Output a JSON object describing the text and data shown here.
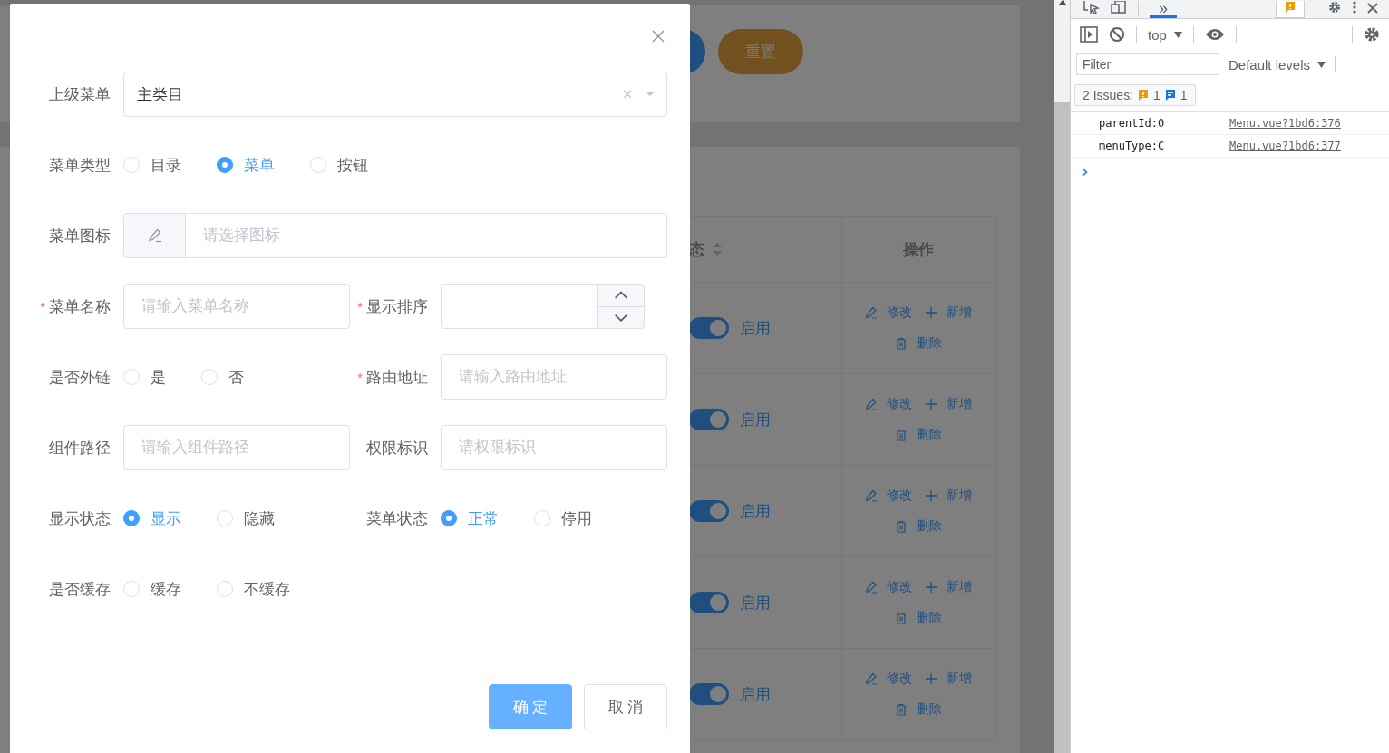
{
  "background_page": {
    "reset_button": "重置",
    "table": {
      "status_header": "态",
      "actions_header": "操作",
      "rows": [
        {
          "on": true,
          "status": "启用",
          "actions": [
            "修改",
            "新增",
            "删除"
          ]
        },
        {
          "on": true,
          "status": "启用",
          "actions": [
            "修改",
            "新增",
            "删除"
          ]
        },
        {
          "on": true,
          "status": "启用",
          "actions": [
            "修改",
            "新增",
            "删除"
          ]
        },
        {
          "on": true,
          "status": "启用",
          "actions": [
            "修改",
            "新增",
            "删除"
          ]
        },
        {
          "on": true,
          "status": "启用",
          "actions": [
            "修改",
            "新增",
            "删除"
          ]
        }
      ]
    }
  },
  "dialog": {
    "rows": [
      {
        "items": [
          {
            "label": "上级菜单",
            "kind": "select",
            "value": "主类目"
          }
        ]
      },
      {
        "items": [
          {
            "label": "菜单类型",
            "kind": "radio",
            "options": [
              {
                "label": "目录",
                "selected": false
              },
              {
                "label": "菜单",
                "selected": true
              },
              {
                "label": "按钮",
                "selected": false
              }
            ]
          }
        ]
      },
      {
        "items": [
          {
            "label": "菜单图标",
            "kind": "icon_input",
            "placeholder": "请选择图标"
          }
        ]
      },
      {
        "items": [
          {
            "label": "菜单名称",
            "required_mark": "*",
            "kind": "input",
            "placeholder": "请输入菜单名称"
          },
          {
            "label": "显示排序",
            "required_mark": "*",
            "kind": "number"
          }
        ]
      },
      {
        "items": [
          {
            "label": "是否外链",
            "kind": "radio",
            "options": [
              {
                "label": "是",
                "selected": false
              },
              {
                "label": "否",
                "selected": false
              }
            ]
          },
          {
            "label": "路由地址",
            "required_mark": "*",
            "kind": "input",
            "placeholder": "请输入路由地址"
          }
        ]
      },
      {
        "items": [
          {
            "label": "组件路径",
            "kind": "input",
            "placeholder": "请输入组件路径"
          },
          {
            "label": "权限标识",
            "kind": "input",
            "placeholder": "请权限标识"
          }
        ]
      },
      {
        "items": [
          {
            "label": "显示状态",
            "kind": "radio",
            "options": [
              {
                "label": "显示",
                "selected": true
              },
              {
                "label": "隐藏",
                "selected": false
              }
            ]
          },
          {
            "label": "菜单状态",
            "kind": "radio",
            "options": [
              {
                "label": "正常",
                "selected": true
              },
              {
                "label": "停用",
                "selected": false
              }
            ]
          }
        ]
      },
      {
        "items": [
          {
            "label": "是否缓存",
            "kind": "radio",
            "options": [
              {
                "label": "缓存",
                "selected": false
              },
              {
                "label": "不缓存",
                "selected": false
              }
            ]
          }
        ]
      }
    ],
    "buttons": [
      {
        "label": "确 定",
        "kind": "primary"
      },
      {
        "label": "取 消",
        "kind": "default"
      }
    ]
  },
  "devtools": {
    "tabs": [
      {
        "label": "»",
        "selected": true
      }
    ],
    "context": "top",
    "filter": {
      "placeholder": "Filter"
    },
    "levels": "Default levels",
    "issues": {
      "label": "2 Issues:",
      "warnings": "1",
      "infos": "1"
    },
    "console": [
      {
        "message": "parentId:0",
        "source": "Menu.vue?1bd6:376"
      },
      {
        "message": "menuType:C",
        "source": "Menu.vue?1bd6:377"
      }
    ]
  }
}
